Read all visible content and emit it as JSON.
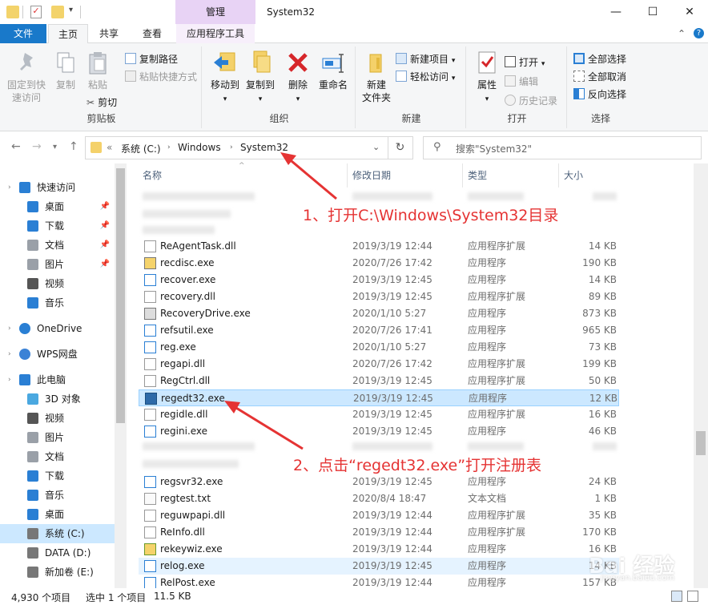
{
  "window": {
    "title": "System32",
    "context_tab": "管理",
    "minimize": "—",
    "maximize": "☐",
    "close": "✕"
  },
  "tabs": {
    "file": "文件",
    "home": "主页",
    "share": "共享",
    "view": "查看",
    "app_tools": "应用程序工具"
  },
  "ribbon": {
    "clipboard": {
      "label": "剪贴板",
      "pin": "固定到快速访问",
      "pin_l1": "固定到快",
      "pin_l2": "速访问",
      "copy": "复制",
      "paste": "粘贴",
      "copy_path": "复制路径",
      "paste_shortcut": "粘贴快捷方式",
      "cut": "剪切"
    },
    "organize": {
      "label": "组织",
      "move_to": "移动到",
      "copy_to": "复制到",
      "delete": "删除",
      "rename": "重命名"
    },
    "new": {
      "label": "新建",
      "new_folder_l1": "新建",
      "new_folder_l2": "文件夹",
      "new_item": "新建项目",
      "easy_access": "轻松访问"
    },
    "open": {
      "label": "打开",
      "properties": "属性",
      "open": "打开",
      "edit": "编辑",
      "history": "历史记录"
    },
    "select": {
      "label": "选择",
      "select_all": "全部选择",
      "select_none": "全部取消",
      "invert": "反向选择"
    }
  },
  "address": {
    "crumbs": [
      "«",
      "系统 (C:)",
      "Windows",
      "System32"
    ],
    "search_placeholder": "搜索\"System32\""
  },
  "nav": {
    "items": [
      {
        "label": "快速访问",
        "icon": "star-icon"
      },
      {
        "label": "桌面",
        "icon": "desktop-icon"
      },
      {
        "label": "下载",
        "icon": "download-icon"
      },
      {
        "label": "文档",
        "icon": "document-icon"
      },
      {
        "label": "图片",
        "icon": "picture-icon"
      },
      {
        "label": "视频",
        "icon": "video-icon"
      },
      {
        "label": "音乐",
        "icon": "music-icon"
      },
      {
        "label": "OneDrive",
        "icon": "cloud-icon"
      },
      {
        "label": "WPS网盘",
        "icon": "wps-cloud-icon"
      },
      {
        "label": "此电脑",
        "icon": "computer-icon"
      },
      {
        "label": "3D 对象",
        "icon": "cube-icon"
      },
      {
        "label": "视频",
        "icon": "video-icon"
      },
      {
        "label": "图片",
        "icon": "picture-icon"
      },
      {
        "label": "文档",
        "icon": "document-icon"
      },
      {
        "label": "下载",
        "icon": "download-icon"
      },
      {
        "label": "音乐",
        "icon": "music-icon"
      },
      {
        "label": "桌面",
        "icon": "desktop-icon"
      },
      {
        "label": "系统 (C:)",
        "icon": "drive-c-icon"
      },
      {
        "label": "DATA (D:)",
        "icon": "drive-icon"
      },
      {
        "label": "新加卷 (E:)",
        "icon": "drive-icon"
      }
    ]
  },
  "list": {
    "columns": {
      "name": "名称",
      "date": "修改日期",
      "type": "类型",
      "size": "大小"
    },
    "files": [
      {
        "name": "ReAgentTask.dll",
        "date": "2019/3/19 12:44",
        "type": "应用程序扩展",
        "size": "14 KB",
        "icon": "dll-icon"
      },
      {
        "name": "recdisc.exe",
        "date": "2020/7/26 17:42",
        "type": "应用程序",
        "size": "190 KB",
        "icon": "disc-exe-icon"
      },
      {
        "name": "recover.exe",
        "date": "2019/3/19 12:45",
        "type": "应用程序",
        "size": "14 KB",
        "icon": "exe-icon"
      },
      {
        "name": "recovery.dll",
        "date": "2019/3/19 12:45",
        "type": "应用程序扩展",
        "size": "89 KB",
        "icon": "dll-icon"
      },
      {
        "name": "RecoveryDrive.exe",
        "date": "2020/1/10 5:27",
        "type": "应用程序",
        "size": "873 KB",
        "icon": "drive-exe-icon"
      },
      {
        "name": "refsutil.exe",
        "date": "2020/7/26 17:41",
        "type": "应用程序",
        "size": "965 KB",
        "icon": "exe-icon"
      },
      {
        "name": "reg.exe",
        "date": "2020/1/10 5:27",
        "type": "应用程序",
        "size": "73 KB",
        "icon": "exe-icon"
      },
      {
        "name": "regapi.dll",
        "date": "2020/7/26 17:42",
        "type": "应用程序扩展",
        "size": "199 KB",
        "icon": "dll-icon"
      },
      {
        "name": "RegCtrl.dll",
        "date": "2019/3/19 12:45",
        "type": "应用程序扩展",
        "size": "50 KB",
        "icon": "dll-icon"
      },
      {
        "name": "regedt32.exe",
        "date": "2019/3/19 12:45",
        "type": "应用程序",
        "size": "12 KB",
        "icon": "regedit-icon",
        "selected": true
      },
      {
        "name": "regidle.dll",
        "date": "2019/3/19 12:45",
        "type": "应用程序扩展",
        "size": "16 KB",
        "icon": "dll-icon"
      },
      {
        "name": "regini.exe",
        "date": "2019/3/19 12:45",
        "type": "应用程序",
        "size": "46 KB",
        "icon": "exe-icon"
      },
      {
        "name": "regsvr32.exe",
        "date": "2019/3/19 12:45",
        "type": "应用程序",
        "size": "24 KB",
        "icon": "exe-icon"
      },
      {
        "name": "regtest.txt",
        "date": "2020/8/4 18:47",
        "type": "文本文档",
        "size": "1 KB",
        "icon": "txt-icon"
      },
      {
        "name": "reguwpapi.dll",
        "date": "2019/3/19 12:44",
        "type": "应用程序扩展",
        "size": "35 KB",
        "icon": "dll-icon"
      },
      {
        "name": "ReInfo.dll",
        "date": "2019/3/19 12:44",
        "type": "应用程序扩展",
        "size": "170 KB",
        "icon": "dll-icon"
      },
      {
        "name": "rekeywiz.exe",
        "date": "2019/3/19 12:44",
        "type": "应用程序",
        "size": "16 KB",
        "icon": "key-exe-icon"
      },
      {
        "name": "relog.exe",
        "date": "2019/3/19 12:45",
        "type": "应用程序",
        "size": "14 KB",
        "icon": "exe-icon"
      },
      {
        "name": "RelPost.exe",
        "date": "2019/3/19 12:44",
        "type": "应用程序",
        "size": "157 KB",
        "icon": "exe-icon"
      }
    ]
  },
  "status": {
    "count": "4,930 个项目",
    "selected": "选中 1 个项目",
    "size": "11.5 KB"
  },
  "annotations": {
    "step1": "1、打开C:\\Windows\\System32目录",
    "step2": "2、点击“regedt32.exe”打开注册表"
  },
  "watermark": {
    "brand": "Bai  经验",
    "site": "jingyan.baidu.com"
  },
  "colors": {
    "accent": "#1979ca",
    "selection": "#cce8ff",
    "annotation": "#e53333",
    "context_tab": "#e8d3f5"
  }
}
